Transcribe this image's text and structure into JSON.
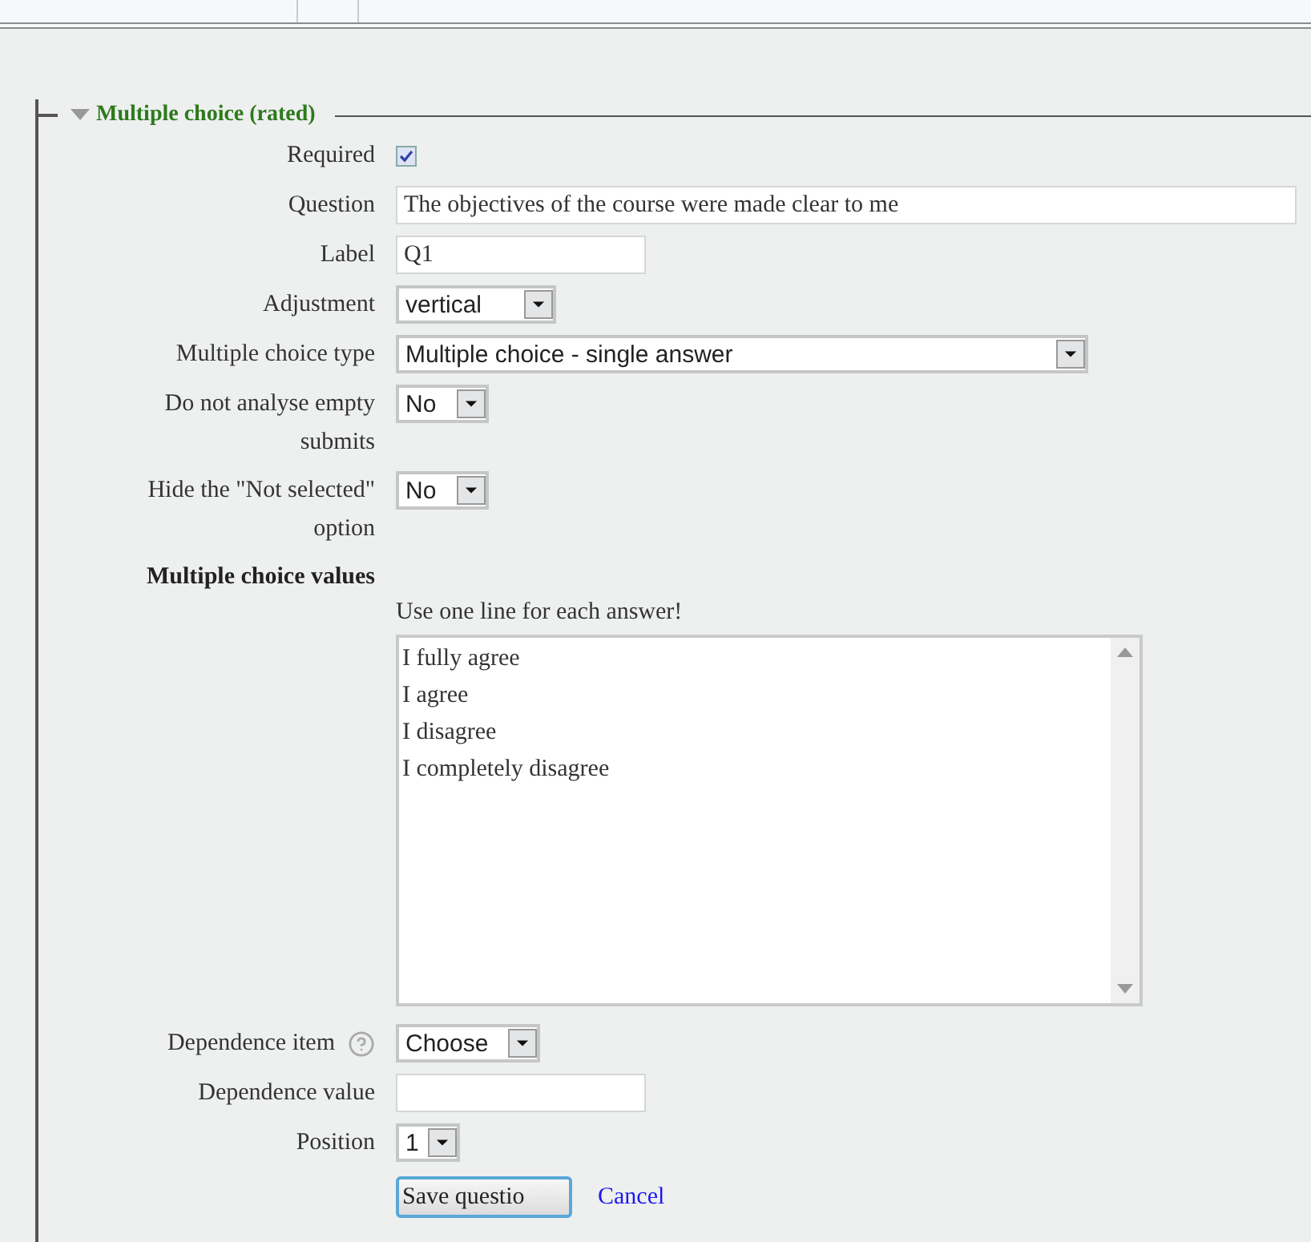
{
  "section": {
    "title": "Multiple choice (rated)",
    "expanded": true
  },
  "fields": [
    {
      "kind": "checkbox",
      "label": "Required",
      "checked": true
    },
    {
      "kind": "text",
      "label": "Question",
      "value": "The objectives of the course were made clear to me"
    },
    {
      "kind": "text",
      "label": "Label",
      "value": "Q1"
    },
    {
      "kind": "select",
      "label": "Adjustment",
      "value": "vertical"
    },
    {
      "kind": "select",
      "label": "Multiple choice type",
      "value": "Multiple choice - single answer"
    },
    {
      "kind": "select",
      "label": "Do not analyse empty submits",
      "value": "No"
    },
    {
      "kind": "select",
      "label": "Hide the \"Not selected\" option",
      "value": "No"
    },
    {
      "kind": "heading",
      "label": "Multiple choice values"
    },
    {
      "kind": "note",
      "text": "Use one line for each answer!"
    },
    {
      "kind": "textarea",
      "lines": [
        "I fully agree",
        "I agree",
        "I disagree",
        "I completely disagree"
      ]
    },
    {
      "kind": "select",
      "label": "Dependence item",
      "help": true,
      "value": "Choose"
    },
    {
      "kind": "text",
      "label": "Dependence value"
    },
    {
      "kind": "select",
      "label": "Position",
      "value": "1"
    }
  ],
  "actions": {
    "save": "Save questio",
    "cancel": "Cancel"
  }
}
